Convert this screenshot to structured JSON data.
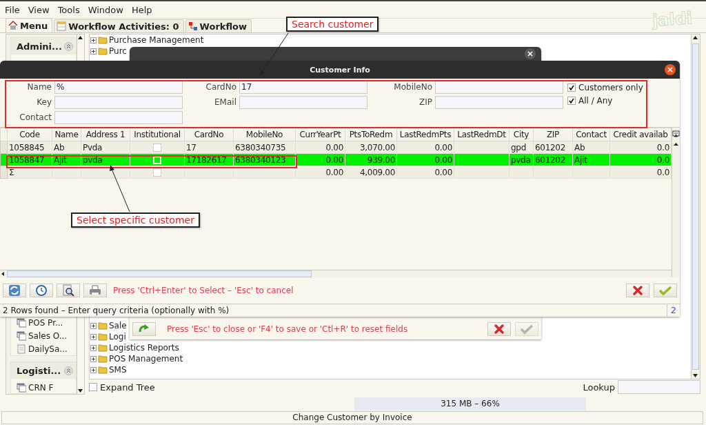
{
  "menubar": [
    "File",
    "View",
    "Tools",
    "Window",
    "Help"
  ],
  "logo": "jaldi",
  "tabs": [
    {
      "label": "Menu",
      "kind": "home",
      "selected": true
    },
    {
      "label": "Workflow Activities: 0",
      "kind": "table",
      "selected": false
    },
    {
      "label": "Workflow",
      "kind": "flow",
      "selected": false
    }
  ],
  "sidebar": {
    "groups": [
      {
        "title": "Admini...",
        "items": [
          {
            "label": "POS Pr...",
            "kind": "form"
          },
          {
            "label": "Sales O...",
            "kind": "form"
          },
          {
            "label": "DailySa...",
            "kind": "report"
          }
        ]
      },
      {
        "title": "Logisti...",
        "items": [
          {
            "label": "CRN F",
            "kind": "form"
          }
        ]
      }
    ]
  },
  "tree": {
    "sections": [
      [
        "Purchase Management",
        "Purc"
      ],
      [
        "Sale",
        "Logi",
        "Logistics Reports",
        "POS Management",
        "SMS"
      ]
    ]
  },
  "expand_tree": {
    "label": "Expand Tree",
    "checked": false
  },
  "lookup": {
    "label": "Lookup"
  },
  "memory": "315 MB – 66%",
  "status_bar": "Change Customer by Invoice",
  "back_dialog": {
    "hint": "Press 'Esc' to close or 'F4' to save or 'Ctl+R' to reset fields",
    "save_disabled": true
  },
  "dialog": {
    "title": "Customer Info",
    "field_columns": [
      [
        {
          "label": "Name",
          "value": "%"
        },
        {
          "label": "Key"
        },
        {
          "label": "Contact"
        }
      ],
      [
        {
          "label": "CardNo",
          "value": "17"
        },
        {
          "label": "EMail"
        }
      ],
      [
        {
          "label": "MobileNo"
        },
        {
          "label": "ZIP"
        }
      ]
    ],
    "options": [
      {
        "label": "Customers only",
        "checked": true
      },
      {
        "label": "All / Any",
        "checked": true
      }
    ],
    "table": {
      "columns": [
        {
          "label": "Code",
          "kind": "text"
        },
        {
          "label": "Name",
          "kind": "text"
        },
        {
          "label": "Address 1",
          "kind": "text"
        },
        {
          "label": "Institutional",
          "kind": "check"
        },
        {
          "label": "CardNo",
          "kind": "text"
        },
        {
          "label": "MobileNo",
          "kind": "text"
        },
        {
          "label": "CurrYearPt",
          "kind": "number"
        },
        {
          "label": "PtsToRedm",
          "kind": "number"
        },
        {
          "label": "LastRedmPts",
          "kind": "number"
        },
        {
          "label": "LastRedmDt",
          "kind": "text"
        },
        {
          "label": "City",
          "kind": "text"
        },
        {
          "label": "ZIP",
          "kind": "text"
        },
        {
          "label": "Contact",
          "kind": "text"
        },
        {
          "label": "Credit availab",
          "kind": "number"
        }
      ],
      "rows": [
        {
          "selected": false,
          "cells": [
            "1058845",
            "Ab",
            "Pvda",
            false,
            "17",
            "6380340735",
            "0.00",
            "3,070.00",
            "0.00",
            null,
            "gpd",
            "601202",
            "Ab",
            "0.0"
          ]
        },
        {
          "selected": true,
          "cells": [
            "1058847",
            "Ajit",
            "pvda",
            false,
            "17182617",
            "6380340123",
            "0.00",
            "939.00",
            "0.00",
            null,
            "pvda",
            "601202",
            "Ajit",
            "0.0"
          ]
        },
        {
          "selected": false,
          "cells": [
            "Σ",
            null,
            null,
            false,
            null,
            null,
            "0.00",
            "4,009.00",
            "0.00",
            null,
            null,
            null,
            null,
            "0.0"
          ]
        }
      ]
    },
    "hint": "Press 'Ctrl+Enter' to Select – 'Esc' to cancel",
    "status": "2 Rows found – Enter query criteria (optionally with %)",
    "count": "2"
  },
  "annotations": [
    "Search customer",
    "Select specific customer"
  ]
}
